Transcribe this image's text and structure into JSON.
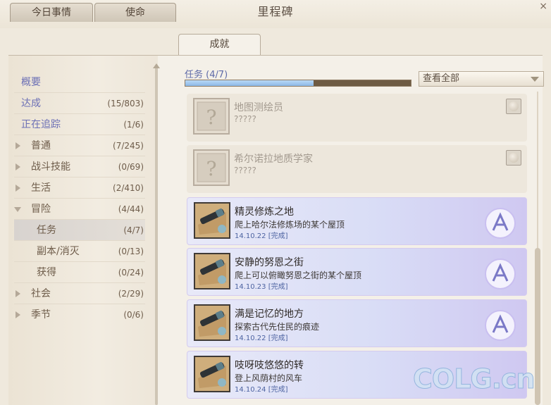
{
  "window": {
    "title": "里程碑",
    "close": "×"
  },
  "tabs": [
    {
      "label": "今日事情"
    },
    {
      "label": "使命"
    },
    {
      "label": "成就"
    }
  ],
  "nav": {
    "items": [
      {
        "label": "概要",
        "count": ""
      },
      {
        "label": "达成",
        "count": "(15/803)"
      },
      {
        "label": "正在追踪",
        "count": "(1/6)"
      },
      {
        "label": "普通",
        "count": "(7/245)"
      },
      {
        "label": "战斗技能",
        "count": "(0/69)"
      },
      {
        "label": "生活",
        "count": "(2/410)"
      },
      {
        "label": "冒险",
        "count": "(4/44)"
      },
      {
        "label": "任务",
        "count": "(4/7)"
      },
      {
        "label": "副本/消灭",
        "count": "(0/13)"
      },
      {
        "label": "获得",
        "count": "(0/24)"
      },
      {
        "label": "社会",
        "count": "(2/29)"
      },
      {
        "label": "季节",
        "count": "(0/6)"
      }
    ]
  },
  "content": {
    "section_label": "任务 (4/7)",
    "progress_fraction": 0.57,
    "view_select": "查看全部",
    "achievements": [
      {
        "name": "地图测绘员",
        "desc": "?????",
        "date": "",
        "status": ""
      },
      {
        "name": "希尔诺拉地质学家",
        "desc": "?????",
        "date": "",
        "status": ""
      },
      {
        "name": "精灵修炼之地",
        "desc": "爬上哈尔法修炼场的某个屋顶",
        "date": "14.10.22",
        "status": "[完成]"
      },
      {
        "name": "安静的努恩之街",
        "desc": "爬上可以俯瞰努恩之街的某个屋顶",
        "date": "14.10.23",
        "status": "[完成]"
      },
      {
        "name": "满是记忆的地方",
        "desc": "探索古代先住民的痕迹",
        "date": "14.10.22",
        "status": "[完成]"
      },
      {
        "name": "吱呀吱悠悠的转",
        "desc": "登上风荫村的风车",
        "date": "14.10.24",
        "status": "[完成]"
      }
    ]
  },
  "watermark": "COLG.cn"
}
